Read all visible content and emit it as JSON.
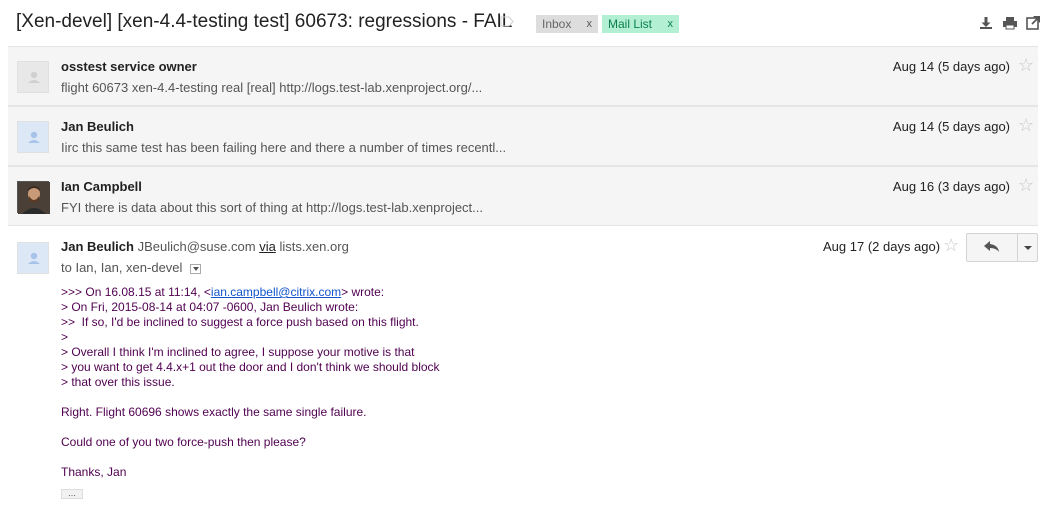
{
  "subject": "[Xen-devel] [xen-4.4-testing test] 60673: regressions - FAIL",
  "labels": [
    {
      "name": "Inbox",
      "remove": "x"
    },
    {
      "name": "Mail List",
      "remove": "x"
    }
  ],
  "toolbar": {
    "icons": [
      "download-icon",
      "print-icon",
      "new-window-icon"
    ]
  },
  "messages": [
    {
      "sender": "osstest service owner",
      "snippet": "flight 60673 xen-4.4-testing real [real] http://logs.test-lab.xenproject.org/...",
      "date": "Aug 14 (5 days ago)",
      "star": "☆"
    },
    {
      "sender": "Jan Beulich",
      "snippet": "Iirc this same test has been failing here and there a number of times recentl...",
      "date": "Aug 14 (5 days ago)",
      "star": "☆"
    },
    {
      "sender": "Ian Campbell",
      "snippet": "FYI there is data about this sort of thing at http://logs.test-lab.xenproject...",
      "date": "Aug 16 (3 days ago)",
      "star": "☆"
    }
  ],
  "open_message": {
    "sender_name": "Jan Beulich",
    "sender_email": "JBeulich@suse.com",
    "via_label": "via",
    "via_host": "lists.xen.org",
    "to": "to Ian, Ian, xen-devel",
    "date": "Aug 17 (2 days ago)",
    "star": "☆",
    "body": {
      "quote_prefix": ">>> On 16.08.15 at 11:14, <",
      "quote_link": "ian.campbell@citrix.com",
      "quote_suffix": "> wrote:",
      "quoted_lines": [
        "> On Fri, 2015-08-14 at 04:07 -0600, Jan Beulich wrote:",
        ">>  If so, I'd be inclined to suggest a force push based on this flight.",
        ">",
        "> Overall I think I'm inclined to agree, I suppose your motive is that",
        "> you want to get 4.4.x+1 out the door and I don't think we should block",
        "> that over this issue."
      ],
      "para1": "Right. Flight 60696 shows exactly the same single failure.",
      "para2": "Could one of you two force-push then please?",
      "signoff": "Thanks, Jan",
      "trimmed": "..."
    }
  }
}
